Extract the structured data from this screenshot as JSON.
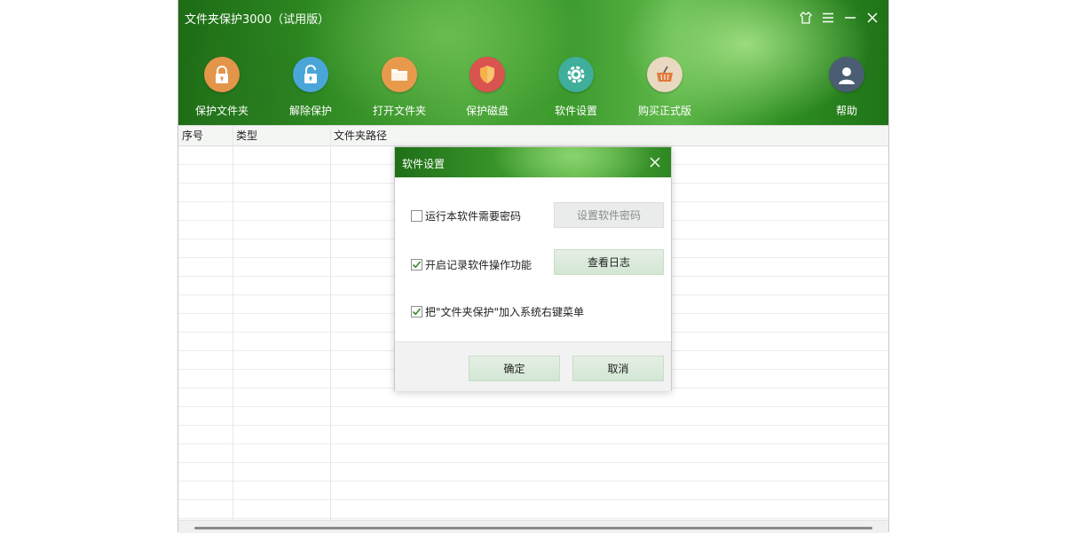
{
  "window": {
    "title": "文件夹保护3000（试用版）"
  },
  "window_controls": [
    "skin-icon",
    "menu-icon",
    "minimize-icon",
    "close-icon"
  ],
  "toolbar": {
    "items": [
      {
        "label": "保护文件夹",
        "icon": "lock-closed-icon",
        "color": "#e3954a"
      },
      {
        "label": "解除保护",
        "icon": "lock-open-icon",
        "color": "#4aa6d8"
      },
      {
        "label": "打开文件夹",
        "icon": "folder-icon",
        "color": "#e89a4c"
      },
      {
        "label": "保护磁盘",
        "icon": "shield-icon",
        "color": "#d9534f"
      },
      {
        "label": "软件设置",
        "icon": "gear-icon",
        "color": "#3fae9a"
      },
      {
        "label": "购买正式版",
        "icon": "basket-icon",
        "color": "#e8d9c0"
      },
      {
        "label": "帮助",
        "icon": "user-icon",
        "color": "#4a5d72"
      }
    ]
  },
  "table": {
    "columns": [
      "序号",
      "类型",
      "文件夹路径"
    ]
  },
  "dialog": {
    "title": "软件设置",
    "options": [
      {
        "label": "运行本软件需要密码",
        "checked": false,
        "button": "设置软件密码",
        "button_enabled": false
      },
      {
        "label": "开启记录软件操作功能",
        "checked": true,
        "button": "查看日志",
        "button_enabled": true
      },
      {
        "label": "把\"文件夹保护\"加入系统右键菜单",
        "checked": true
      }
    ],
    "ok_label": "确定",
    "cancel_label": "取消"
  },
  "colors": {
    "header_green": "#2f8a22",
    "button_green": "#d3e6d4",
    "check_green": "#3a8a2a"
  }
}
